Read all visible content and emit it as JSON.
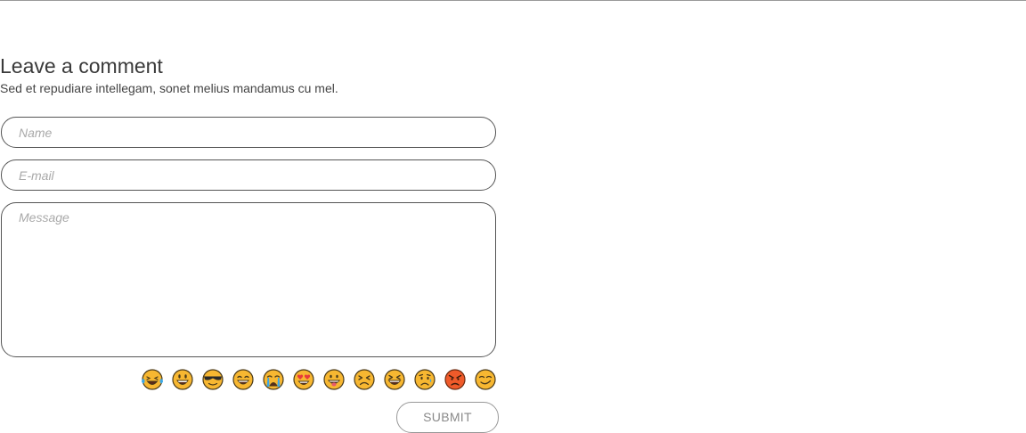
{
  "comment": {
    "heading": "Leave a comment",
    "subheading": "Sed et repudiare intellegam, sonet melius mandamus cu mel."
  },
  "form": {
    "name_placeholder": "Name",
    "email_placeholder": "E-mail",
    "message_placeholder": "Message",
    "submit_label": "SUBMIT"
  },
  "emojis": [
    "laughing-tears-emoji",
    "big-grin-emoji",
    "sunglasses-emoji",
    "grin-emoji",
    "crying-emoji",
    "heart-eyes-emoji",
    "tongue-out-emoji",
    "squinting-frown-emoji",
    "grinning-squint-emoji",
    "worried-emoji",
    "angry-emoji",
    "smirk-emoji"
  ],
  "colors": {
    "emoji_face": "#f7b731",
    "emoji_face_angry": "#ef5a2a",
    "emoji_outline": "#4a3a1a",
    "tear": "#3ba7e6",
    "heart": "#e83b3b"
  }
}
